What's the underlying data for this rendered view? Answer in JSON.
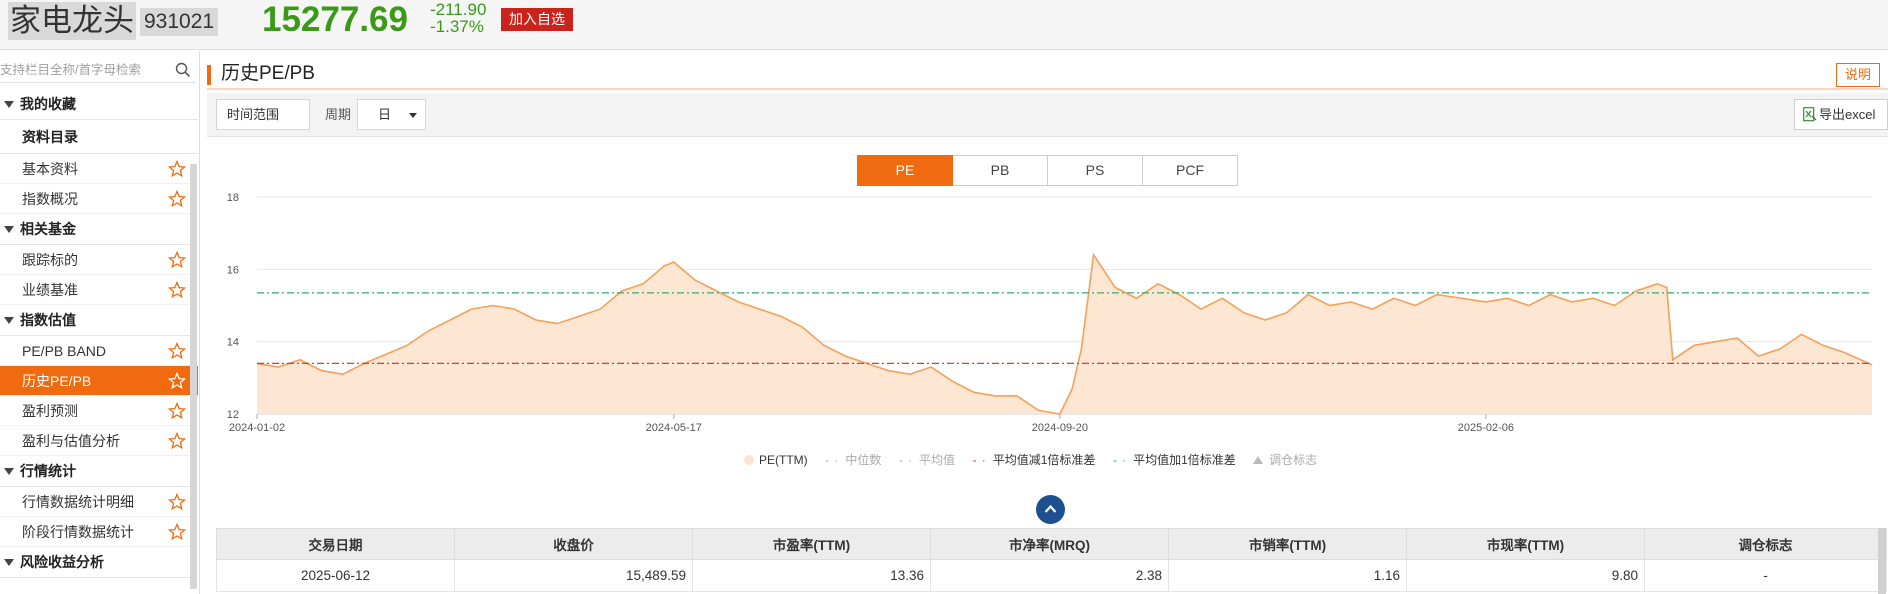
{
  "header": {
    "index_name": "家电龙头",
    "index_code": "931021",
    "price": "15277.69",
    "change": "-211.90",
    "change_pct": "-1.37%",
    "add_fav_label": "加入自选",
    "price_color": "#3a9a18"
  },
  "sidebar": {
    "search_placeholder": "支持栏目全称/首字母检索",
    "groups": [
      {
        "label": "我的收藏"
      },
      {
        "label": "相关基金"
      },
      {
        "label": "指数估值"
      },
      {
        "label": "行情统计"
      },
      {
        "label": "风险收益分析"
      }
    ],
    "catalog_label": "资料目录",
    "items": [
      {
        "label": "基本资料"
      },
      {
        "label": "指数概况"
      },
      {
        "label": "跟踪标的"
      },
      {
        "label": "业绩基准"
      },
      {
        "label": "PE/PB BAND"
      },
      {
        "label": "历史PE/PB"
      },
      {
        "label": "盈利预测"
      },
      {
        "label": "盈利与估值分析"
      },
      {
        "label": "行情数据统计明细"
      },
      {
        "label": "阶段行情数据统计"
      }
    ],
    "active_item": "历史PE/PB"
  },
  "panel": {
    "title": "历史PE/PB",
    "explain_label": "说明",
    "range_label": "时间范围",
    "period_label": "周期",
    "period_value": "日",
    "export_label": "导出excel",
    "accent_color": "#f06a0f"
  },
  "chart_tabs": [
    {
      "label": "PE",
      "active": true
    },
    {
      "label": "PB",
      "active": false
    },
    {
      "label": "PS",
      "active": false
    },
    {
      "label": "PCF",
      "active": false
    }
  ],
  "chart_data": {
    "type": "area",
    "ylim": [
      12,
      18
    ],
    "yticks": [
      12,
      14,
      16,
      18
    ],
    "xticks": [
      "2024-01-02",
      "2024-05-17",
      "2024-09-20",
      "2025-02-06"
    ],
    "x_range": [
      "2024-01-02",
      "2025-06-12"
    ],
    "grid": true,
    "series": [
      {
        "name": "PE(TTM)",
        "color": "#f5a05a",
        "fill": "#fde6d2",
        "points": [
          [
            "2024-01-02",
            13.4
          ],
          [
            "2024-01-09",
            13.3
          ],
          [
            "2024-01-16",
            13.5
          ],
          [
            "2024-01-23",
            13.2
          ],
          [
            "2024-01-30",
            13.1
          ],
          [
            "2024-02-06",
            13.4
          ],
          [
            "2024-02-20",
            13.9
          ],
          [
            "2024-02-27",
            14.3
          ],
          [
            "2024-03-05",
            14.6
          ],
          [
            "2024-03-12",
            14.9
          ],
          [
            "2024-03-19",
            15.0
          ],
          [
            "2024-03-26",
            14.9
          ],
          [
            "2024-04-02",
            14.6
          ],
          [
            "2024-04-09",
            14.5
          ],
          [
            "2024-04-16",
            14.7
          ],
          [
            "2024-04-23",
            14.9
          ],
          [
            "2024-04-30",
            15.4
          ],
          [
            "2024-05-07",
            15.6
          ],
          [
            "2024-05-14",
            16.1
          ],
          [
            "2024-05-17",
            16.2
          ],
          [
            "2024-05-24",
            15.7
          ],
          [
            "2024-05-31",
            15.4
          ],
          [
            "2024-06-07",
            15.1
          ],
          [
            "2024-06-14",
            14.9
          ],
          [
            "2024-06-21",
            14.7
          ],
          [
            "2024-06-28",
            14.4
          ],
          [
            "2024-07-05",
            13.9
          ],
          [
            "2024-07-12",
            13.6
          ],
          [
            "2024-07-19",
            13.4
          ],
          [
            "2024-07-26",
            13.2
          ],
          [
            "2024-08-02",
            13.1
          ],
          [
            "2024-08-09",
            13.3
          ],
          [
            "2024-08-16",
            12.9
          ],
          [
            "2024-08-23",
            12.6
          ],
          [
            "2024-08-30",
            12.5
          ],
          [
            "2024-09-06",
            12.5
          ],
          [
            "2024-09-13",
            12.1
          ],
          [
            "2024-09-20",
            12.0
          ],
          [
            "2024-09-24",
            12.7
          ],
          [
            "2024-09-27",
            13.8
          ],
          [
            "2024-10-01",
            16.4
          ],
          [
            "2024-10-08",
            15.5
          ],
          [
            "2024-10-15",
            15.2
          ],
          [
            "2024-10-22",
            15.6
          ],
          [
            "2024-10-29",
            15.3
          ],
          [
            "2024-11-05",
            14.9
          ],
          [
            "2024-11-12",
            15.2
          ],
          [
            "2024-11-19",
            14.8
          ],
          [
            "2024-11-26",
            14.6
          ],
          [
            "2024-12-03",
            14.8
          ],
          [
            "2024-12-10",
            15.3
          ],
          [
            "2024-12-17",
            15.0
          ],
          [
            "2024-12-24",
            15.1
          ],
          [
            "2024-12-31",
            14.9
          ],
          [
            "2025-01-07",
            15.2
          ],
          [
            "2025-01-14",
            15.0
          ],
          [
            "2025-01-21",
            15.3
          ],
          [
            "2025-02-06",
            15.1
          ],
          [
            "2025-02-13",
            15.2
          ],
          [
            "2025-02-20",
            15.0
          ],
          [
            "2025-02-27",
            15.3
          ],
          [
            "2025-03-06",
            15.1
          ],
          [
            "2025-03-13",
            15.2
          ],
          [
            "2025-03-20",
            15.0
          ],
          [
            "2025-03-27",
            15.4
          ],
          [
            "2025-04-03",
            15.6
          ],
          [
            "2025-04-06",
            15.5
          ],
          [
            "2025-04-08",
            13.5
          ],
          [
            "2025-04-15",
            13.9
          ],
          [
            "2025-04-22",
            14.0
          ],
          [
            "2025-04-29",
            14.1
          ],
          [
            "2025-05-06",
            13.6
          ],
          [
            "2025-05-13",
            13.8
          ],
          [
            "2025-05-20",
            14.2
          ],
          [
            "2025-05-27",
            13.9
          ],
          [
            "2025-06-03",
            13.7
          ],
          [
            "2025-06-12",
            13.36
          ]
        ]
      }
    ],
    "ref_lines": [
      {
        "name": "平均值加1倍标准差",
        "value": 15.35,
        "color": "#3aa57a"
      },
      {
        "name": "平均值减1倍标准差",
        "value": 13.4,
        "color": "#d93b3b"
      }
    ]
  },
  "legend": [
    {
      "label": "PE(TTM)",
      "active": true
    },
    {
      "label": "中位数",
      "active": false
    },
    {
      "label": "平均值",
      "active": false
    },
    {
      "label": "平均值减1倍标准差",
      "active": true
    },
    {
      "label": "平均值加1倍标准差",
      "active": true
    },
    {
      "label": "调仓标志",
      "active": false
    }
  ],
  "table": {
    "headers": [
      "交易日期",
      "收盘价",
      "市盈率(TTM)",
      "市净率(MRQ)",
      "市销率(TTM)",
      "市现率(TTM)",
      "调仓标志"
    ],
    "rows": [
      [
        "2025-06-12",
        "15,489.59",
        "13.36",
        "2.38",
        "1.16",
        "9.80",
        "-"
      ]
    ]
  }
}
